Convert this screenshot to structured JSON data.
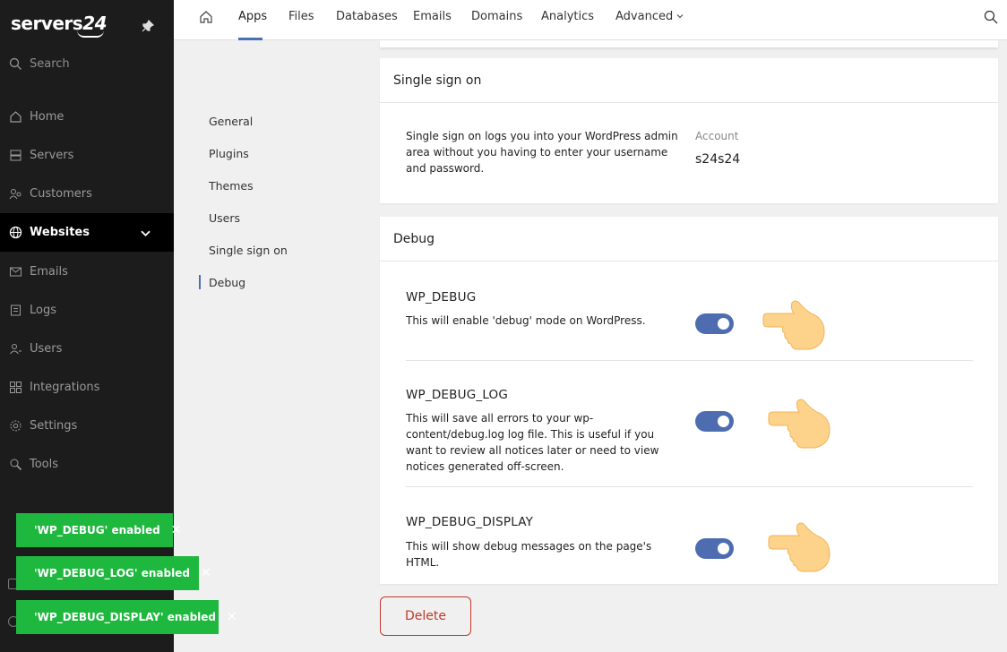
{
  "sidebar": {
    "logo_text": "servers",
    "logo_num": "24",
    "search_label": "Search",
    "items": [
      {
        "label": "Home",
        "icon": "home-icon"
      },
      {
        "label": "Servers",
        "icon": "server-icon"
      },
      {
        "label": "Customers",
        "icon": "customers-icon"
      },
      {
        "label": "Websites",
        "icon": "globe-icon",
        "active": true
      },
      {
        "label": "Emails",
        "icon": "mail-icon"
      },
      {
        "label": "Logs",
        "icon": "logs-icon"
      },
      {
        "label": "Users",
        "icon": "users-icon"
      },
      {
        "label": "Integrations",
        "icon": "integrations-icon"
      },
      {
        "label": "Settings",
        "icon": "gear-icon"
      },
      {
        "label": "Tools",
        "icon": "tools-icon"
      }
    ]
  },
  "toasts": [
    "'WP_DEBUG' enabled",
    "'WP_DEBUG_LOG' enabled",
    "'WP_DEBUG_DISPLAY' enabled"
  ],
  "topbar": {
    "tabs": [
      "Apps",
      "Files",
      "Databases",
      "Emails",
      "Domains",
      "Analytics",
      "Advanced"
    ],
    "active_tab": "Apps"
  },
  "subnav": [
    "General",
    "Plugins",
    "Themes",
    "Users",
    "Single sign on",
    "Debug"
  ],
  "sso": {
    "title": "Single sign on",
    "description": "Single sign on logs you into your WordPress admin area without you having to enter your username and password.",
    "account_label": "Account",
    "account_value": "s24s24"
  },
  "debug": {
    "title": "Debug",
    "options": [
      {
        "name": "WP_DEBUG",
        "description": "This will enable 'debug' mode on WordPress.",
        "enabled": true
      },
      {
        "name": "WP_DEBUG_LOG",
        "description": "This will save all errors to your wp-content/debug.log log file. This is useful if you want to review all notices later or need to view notices generated off-screen.",
        "enabled": true
      },
      {
        "name": "WP_DEBUG_DISPLAY",
        "description": "This will show debug messages on the page's HTML.",
        "enabled": true
      }
    ]
  },
  "delete_label": "Delete",
  "colors": {
    "sidebar_bg": "#1c1c1c",
    "accent": "#4e6db0",
    "toast_bg": "#1fb83f",
    "danger": "#c0392b"
  }
}
